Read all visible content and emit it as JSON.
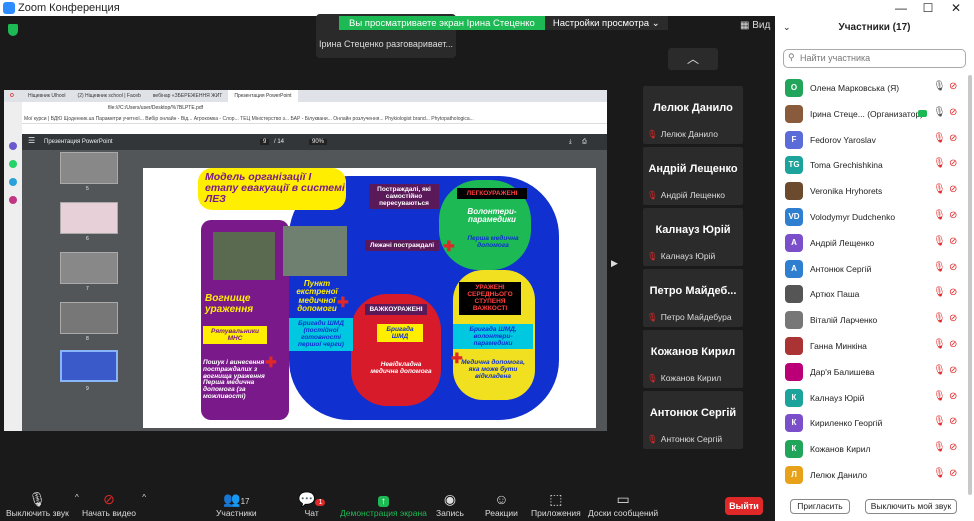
{
  "window": {
    "title": "Zoom Конференция",
    "controls": [
      "—",
      "☐",
      "✕"
    ]
  },
  "banner": {
    "viewing": "Вы просматриваете экран Ірина Стеценко",
    "view_settings": "Настройки просмотра"
  },
  "speaking": "Ірина Стеценко разговаривает...",
  "view_label": "Вид",
  "browser": {
    "tabs": [
      "Ніщевник Ulhool",
      "(2) Ніщевник school | Faceb",
      "вебінар «ЗБЕРЕЖЕННЯ ЖИТ",
      "Презентация PowerPoint"
    ],
    "address": "file:///C:/Users/user/Desktop/%7BLPTE.pdf",
    "bookmarks": "Мої курси | ВДЮ   Щоденник.ua   Параметри учетної...   Вибір онлайн - Від...   Агрокомка - Слор...   ТЕЦ Міністерство з...   БАР - Білуквани...   Онлайн розлучення...   Phykiologist brand...   Phytopathologica..."
  },
  "pdf": {
    "title": "Презентация PowerPoint",
    "page": "9",
    "total": "/ 14",
    "zoom": "90%",
    "thumb_nums": [
      "5",
      "6",
      "7",
      "8",
      "9"
    ]
  },
  "slide": {
    "title": "Модель організації І етапу евакуації в системі ЛЕЗ",
    "left_zone": "Вогнище ураження",
    "rescuers": "Рятувальники МНС",
    "search": "Пошук і винесення постраждалих з вогнища ураження Перша медична допомога (за можливості)",
    "point": "Пункт екстреної медичної допомоги",
    "brigade1": "Бригади ШМД (постійної готовності першої черги)",
    "walking": "Постраждалі, які самостійно пересуваються",
    "lying": "Лежачі постраждалі",
    "light": "ЛЕГКОУРАЖЕНІ",
    "volunteers": "Волонтери-парамедики",
    "first_aid": "Перша медична допомога",
    "heavy": "ВАЖКОУРАЖЕНІ",
    "brigade2": "Бригада ШМД",
    "urgent": "Невідкладна медична допомога",
    "medium": "УРАЖЕНІ СЕРЕДНЬОГО СТУПЕНЯ ВАЖКОСТІ",
    "brigade3": "Бригада ШМД, волонтери-парамедики",
    "deferred": "Медична допомога, яка може бути відкладена"
  },
  "tiles": [
    {
      "name": "Лелюк Данило",
      "sub": "Лелюк Данило"
    },
    {
      "name": "Андрій Лещенко",
      "sub": "Андрій Лещенко"
    },
    {
      "name": "Калнауз Юрій",
      "sub": "Калнауз Юрій"
    },
    {
      "name": "Петро Майдеб...",
      "sub": "Петро Майдебура"
    },
    {
      "name": "Кожанов Кирил",
      "sub": "Кожанов Кирил"
    },
    {
      "name": "Антонюк Сергій",
      "sub": "Антонюк Сергій"
    }
  ],
  "toolbar": {
    "mute": "Выключить звук",
    "video": "Начать видео",
    "participants": "Участники",
    "participants_count": "17",
    "chat": "Чат",
    "chat_badge": "1",
    "share": "Демонстрация экрана",
    "record": "Запись",
    "reactions": "Реакции",
    "apps": "Приложения",
    "whiteboard": "Доски сообщений",
    "end": "Выйти"
  },
  "panel": {
    "title": "Участники (17)",
    "search_placeholder": "Найти участника",
    "invite": "Пригласить",
    "mute_all": "Выключить мой звук",
    "participants": [
      {
        "initial": "О",
        "color": "#21a55b",
        "name": "Олена Марковська (Я)",
        "mic_on": true
      },
      {
        "initial": "",
        "color": "#8a5a3c",
        "name": "Ірина Стеце... (Организатор)",
        "mic_on": true,
        "host": true
      },
      {
        "initial": "F",
        "color": "#5b6cd9",
        "name": "Fedorov Yaroslav"
      },
      {
        "initial": "TG",
        "color": "#1ba39c",
        "name": "Toma Grechishkina"
      },
      {
        "initial": "",
        "color": "#6b4a2e",
        "name": "Veronika Hryhorets"
      },
      {
        "initial": "VD",
        "color": "#2f7fd1",
        "name": "Volodymyr Dudchenko"
      },
      {
        "initial": "А",
        "color": "#7b4fc9",
        "name": "Андрій Лещенко"
      },
      {
        "initial": "А",
        "color": "#2f7fd1",
        "name": "Антонюк Сергій"
      },
      {
        "initial": "",
        "color": "#555",
        "name": "Артюх Паша"
      },
      {
        "initial": "",
        "color": "#777",
        "name": "Віталій Ларченко"
      },
      {
        "initial": "",
        "color": "#a33",
        "name": "Ганна Минкіна"
      },
      {
        "initial": "",
        "color": "#b07",
        "name": "Дар'я Балишева"
      },
      {
        "initial": "К",
        "color": "#1ba39c",
        "name": "Калнауз Юрій"
      },
      {
        "initial": "К",
        "color": "#7b4fc9",
        "name": "Кириленко Георгій"
      },
      {
        "initial": "К",
        "color": "#21a55b",
        "name": "Кожанов Кирил"
      },
      {
        "initial": "Л",
        "color": "#e8a21a",
        "name": "Лелюк Данило"
      }
    ]
  }
}
